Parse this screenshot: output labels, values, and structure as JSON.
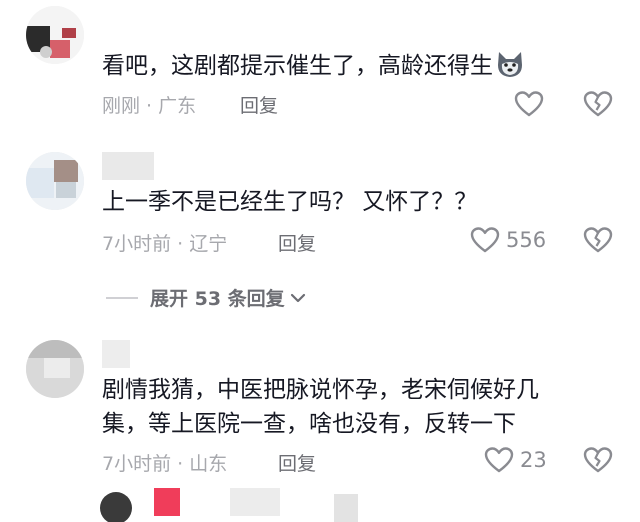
{
  "comments": [
    {
      "text": "看吧，这剧都提示催生了，高龄还得生",
      "emoji": "wolf-face-emoji",
      "meta": "刚刚 · 广东",
      "reply_label": "回复",
      "likes": ""
    },
    {
      "text": "上一季不是已经生了吗？ 又怀了？？",
      "meta": "7小时前 · 辽宁",
      "reply_label": "回复",
      "likes": "556"
    },
    {
      "text_line1": "剧情我猜，中医把脉说怀孕，老宋伺候好几",
      "text_line2": "集，等上医院一查，啥也没有，反转一下",
      "meta": "7小时前 · 山东",
      "reply_label": "回复",
      "likes": "23"
    }
  ],
  "expand_replies": {
    "label": "展开 53 条回复"
  },
  "colors": {
    "text": "#161823",
    "meta": "#a7a8ad",
    "icon": "#8a8b91"
  }
}
